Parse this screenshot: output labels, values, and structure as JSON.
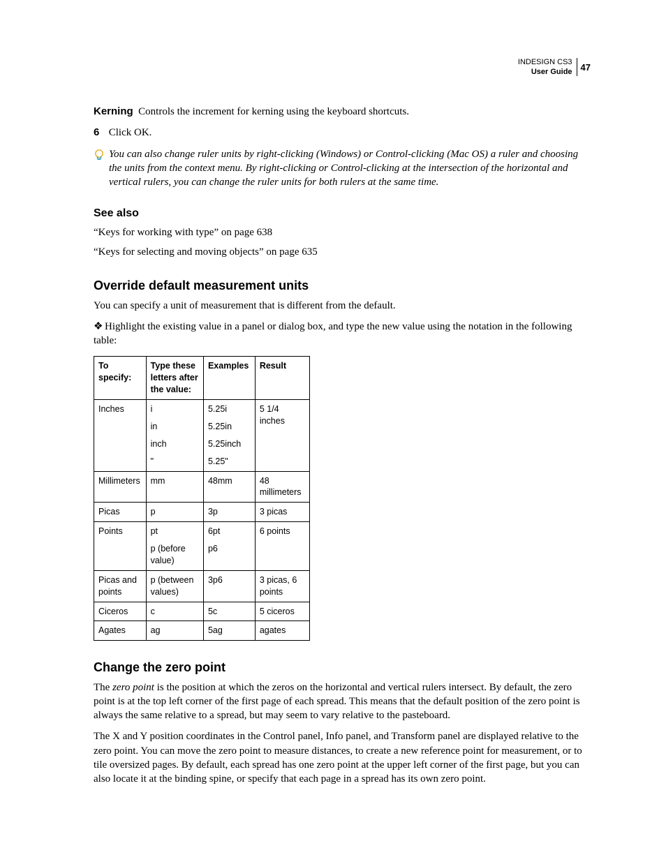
{
  "header": {
    "product": "INDESIGN CS3",
    "guide": "User Guide",
    "page_number": "47"
  },
  "body": {
    "kerning_label": "Kerning",
    "kerning_text": "Controls the increment for kerning using the keyboard shortcuts.",
    "step6_num": "6",
    "step6_text": "Click OK.",
    "tip_text": "You can also change ruler units by right-clicking (Windows) or Control-clicking (Mac OS) a ruler and choosing the units from the context menu. By right-clicking or Control-clicking at the intersection of the horizontal and vertical rulers, you can change the ruler units for both rulers at the same time.",
    "see_also_heading": "See also",
    "see_also_1": "“Keys for working with type” on page 638",
    "see_also_2": "“Keys for selecting and moving objects” on page 635",
    "section_override_heading": "Override default measurement units",
    "override_intro": "You can specify a unit of measurement that is different from the default.",
    "override_bullet": "Highlight the existing value in a panel or dialog box, and type the new value using the notation in the following table:",
    "section_zero_heading": "Change the zero point",
    "zero_p1_a": "The ",
    "zero_p1_term": "zero point",
    "zero_p1_b": " is the position at which the zeros on the horizontal and vertical rulers intersect. By default, the zero point is at the top left corner of the first page of each spread. This means that the default position of the zero point is always the same relative to a spread, but may seem to vary relative to the pasteboard.",
    "zero_p2": "The X and Y position coordinates in the Control panel, Info panel, and Transform panel are displayed relative to the zero point. You can move the zero point to measure distances, to create a new reference point for measurement, or to tile oversized pages. By default, each spread has one zero point at the upper left corner of the first page, but you can also locate it at the binding spine, or specify that each page in a spread has its own zero point."
  },
  "table": {
    "headers": {
      "c1": "To specify:",
      "c2": "Type these letters after the value:",
      "c3": "Examples",
      "c4": "Result"
    },
    "rows": [
      {
        "c1": "Inches",
        "c2": [
          "i",
          "in",
          "inch",
          "\""
        ],
        "c3": [
          "5.25i",
          "5.25in",
          "5.25inch",
          "5.25\""
        ],
        "c4": "5 1/4 inches"
      },
      {
        "c1": "Millimeters",
        "c2": [
          "mm"
        ],
        "c3": [
          "48mm"
        ],
        "c4": "48 millimeters"
      },
      {
        "c1": "Picas",
        "c2": [
          "p"
        ],
        "c3": [
          "3p"
        ],
        "c4": "3 picas"
      },
      {
        "c1": "Points",
        "c2": [
          "pt",
          "p (before value)"
        ],
        "c3": [
          "6pt",
          "p6"
        ],
        "c4": "6 points"
      },
      {
        "c1": "Picas and points",
        "c2": [
          "p (between values)"
        ],
        "c3": [
          "3p6"
        ],
        "c4": "3 picas, 6 points"
      },
      {
        "c1": "Ciceros",
        "c2": [
          "c"
        ],
        "c3": [
          "5c"
        ],
        "c4": "5 ciceros"
      },
      {
        "c1": "Agates",
        "c2": [
          "ag"
        ],
        "c3": [
          "5ag"
        ],
        "c4": "agates"
      }
    ]
  }
}
